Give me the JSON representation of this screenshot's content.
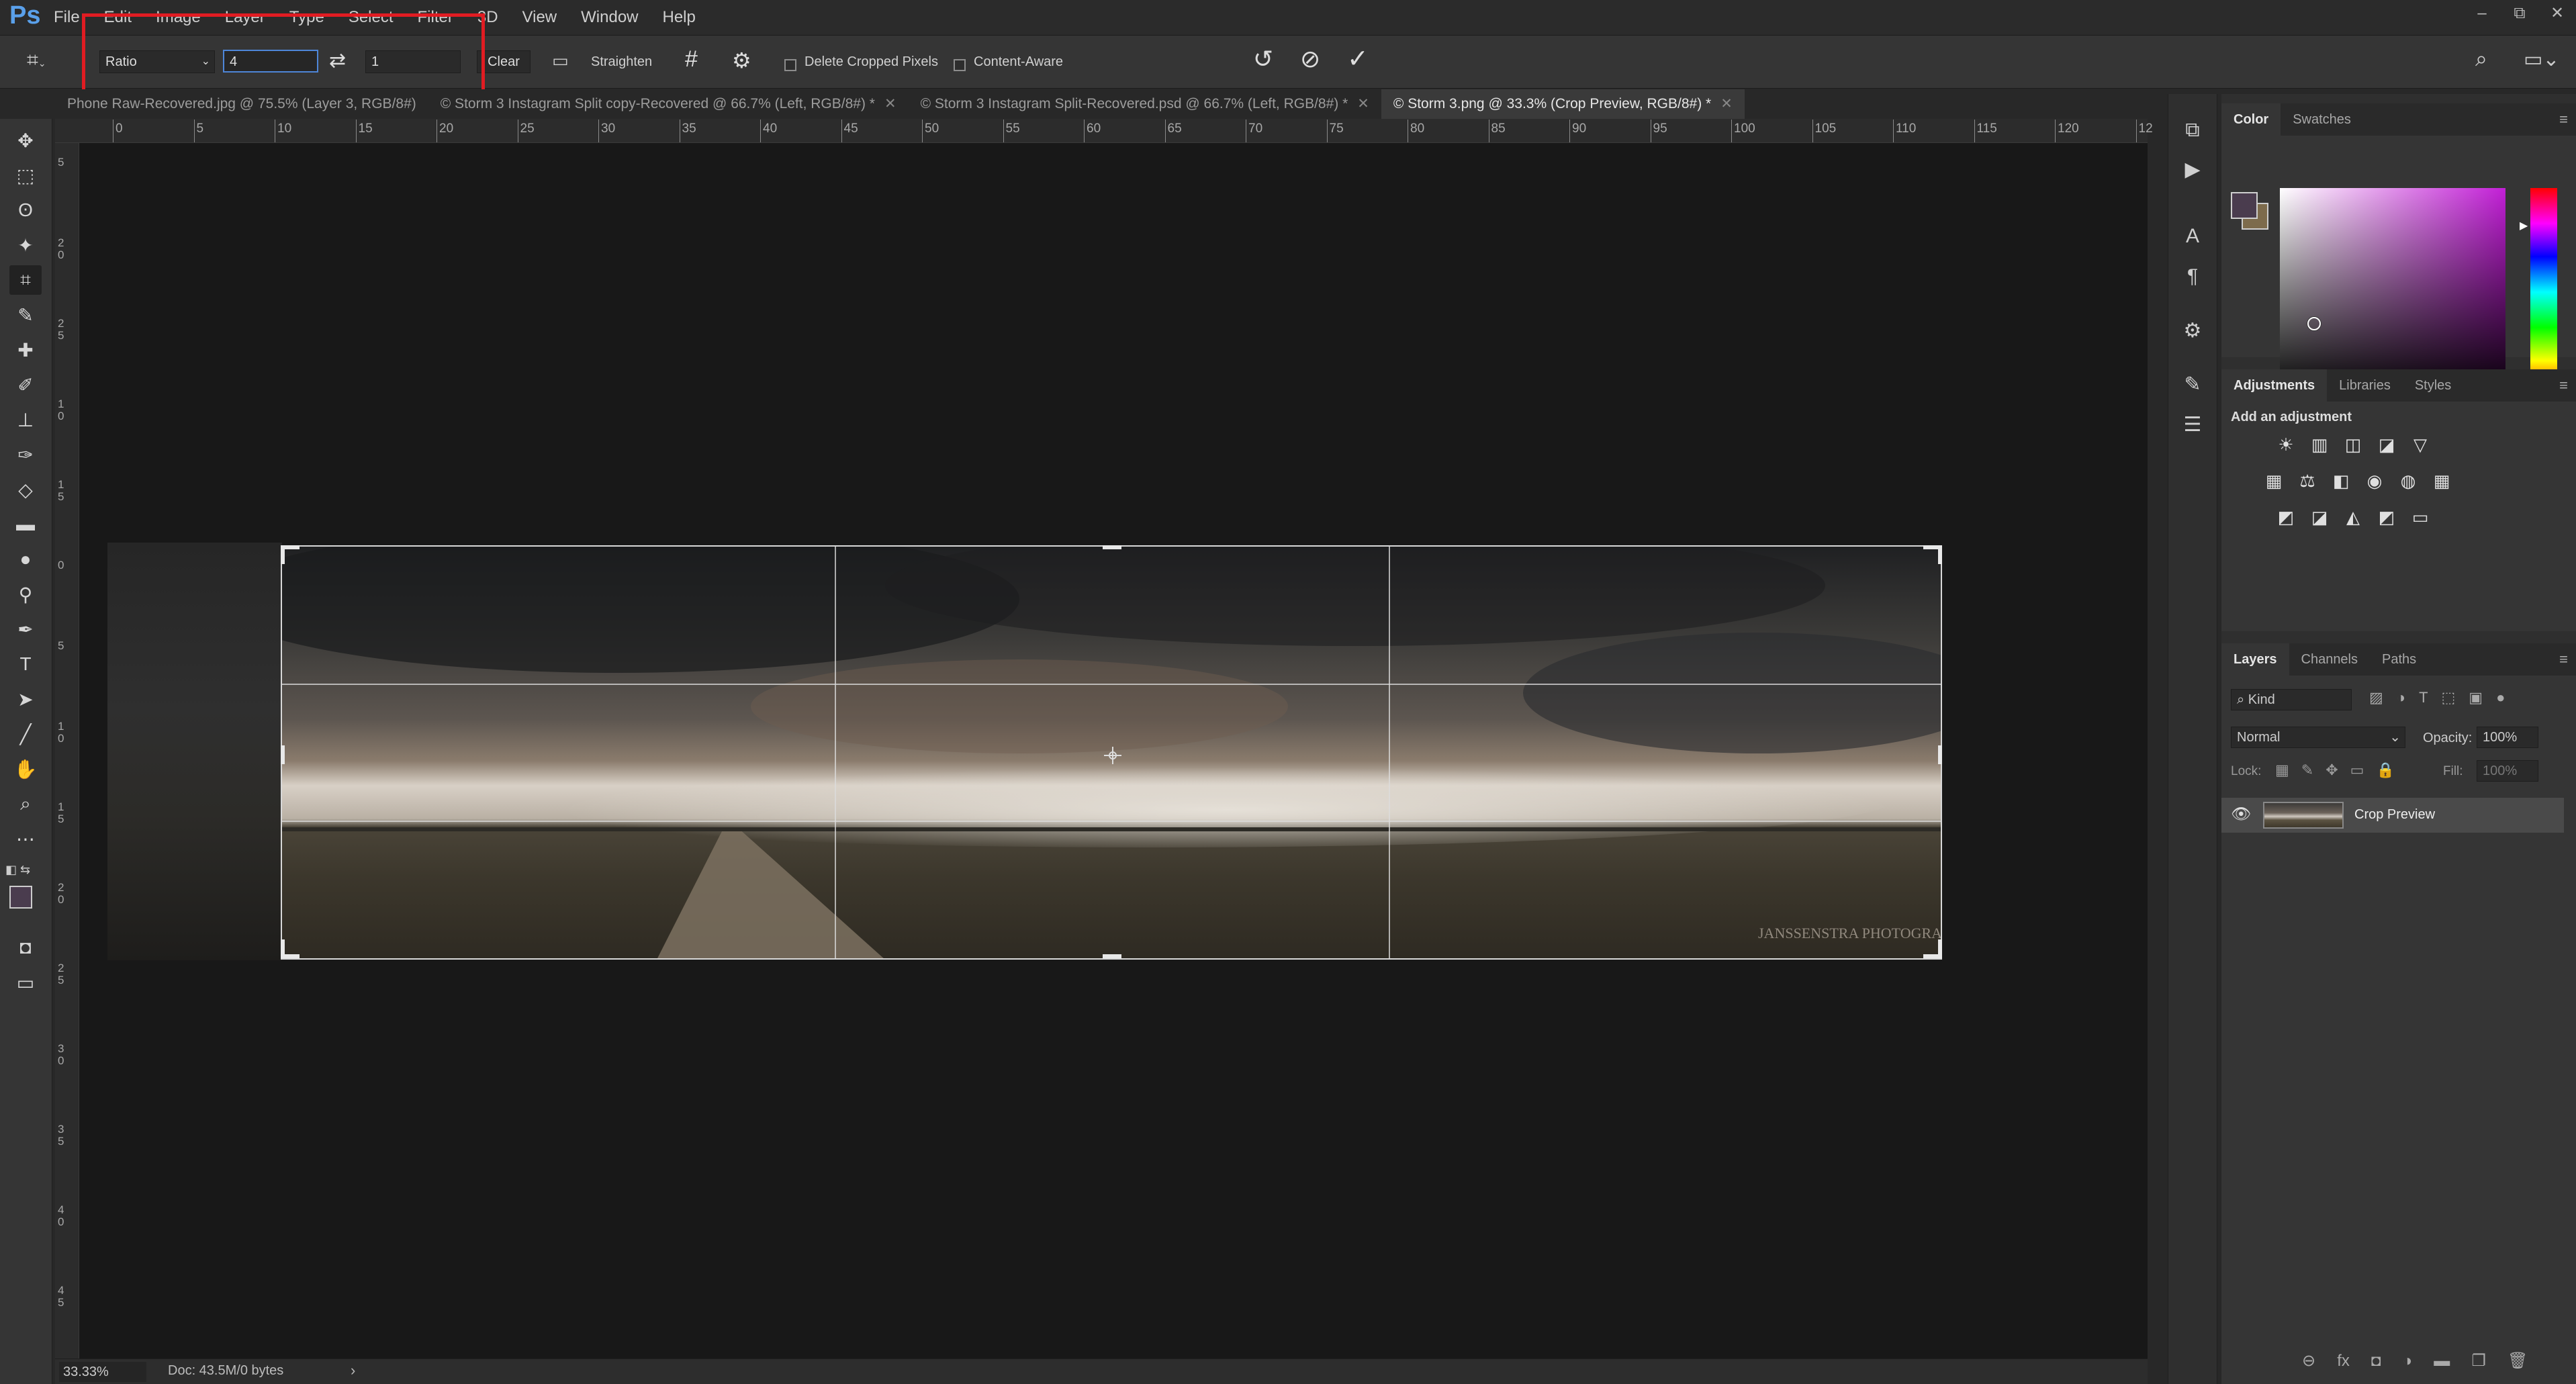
{
  "app": {
    "logo": "Ps"
  },
  "menu": [
    "File",
    "Edit",
    "Image",
    "Layer",
    "Type",
    "Select",
    "Filter",
    "3D",
    "View",
    "Window",
    "Help"
  ],
  "window_controls": [
    "–",
    "⧉",
    "✕"
  ],
  "options_bar": {
    "ratio_preset": "Ratio",
    "ratio_width": "4",
    "ratio_height": "1",
    "swap_icon": "swap-arrows-icon",
    "clear_label": "Clear",
    "straighten_label": "Straighten",
    "delete_cropped_label": "Delete Cropped Pixels",
    "delete_cropped_checked": false,
    "content_aware_label": "Content-Aware",
    "content_aware_checked": false,
    "highlight_color": "#e11c22"
  },
  "tabs": [
    {
      "label": "Phone Raw-Recovered.jpg @ 75.5% (Layer 3, RGB/8#)",
      "close": ""
    },
    {
      "label": "© Storm 3 Instagram Split copy-Recovered @ 66.7% (Left, RGB/8#) *",
      "close": "✕"
    },
    {
      "label": "© Storm 3 Instagram Split-Recovered.psd @ 66.7% (Left, RGB/8#) *",
      "close": "✕"
    },
    {
      "label": "© Storm 3.png @ 33.3% (Crop Preview, RGB/8#) *",
      "close": "✕",
      "active": true
    }
  ],
  "ruler": {
    "top_labels": [
      "0",
      "5",
      "10",
      "15",
      "20",
      "25",
      "30",
      "35",
      "40",
      "45",
      "50",
      "55",
      "60",
      "65",
      "70",
      "75",
      "80",
      "85",
      "90",
      "95",
      "100",
      "105",
      "110",
      "115",
      "120",
      "12"
    ],
    "left_labels": [
      "5",
      "2 0",
      "2 5",
      "1 0",
      "1 5",
      "0",
      "5",
      "1 0",
      "1 5",
      "2 0",
      "2 5",
      "3 0",
      "3 5",
      "4 0",
      "4 5"
    ]
  },
  "status": {
    "zoom": "33.33%",
    "doc": "Doc: 43.5M/0 bytes",
    "arrow": "›"
  },
  "color_panel": {
    "tabs": [
      "Color",
      "Swatches"
    ],
    "foreground": "#4a3c4e",
    "background": "#7d6b4c",
    "hue_color": "#c21fd6"
  },
  "adjustments_panel": {
    "tabs": [
      "Adjustments",
      "Libraries",
      "Styles"
    ],
    "heading": "Add an adjustment",
    "row1": [
      "☀",
      "▥",
      "◫",
      "◪",
      "▽"
    ],
    "row2": [
      "▦",
      "⚖",
      "◧",
      "◉",
      "◍",
      "▦"
    ],
    "row3": [
      "◩",
      "◪",
      "◭",
      "◩",
      "▭"
    ]
  },
  "layers_panel": {
    "tabs": [
      "Layers",
      "Channels",
      "Paths"
    ],
    "filter_placeholder": "Kind",
    "blend_mode": "Normal",
    "opacity_label": "Opacity:",
    "opacity": "100%",
    "lock_label": "Lock:",
    "fill_label": "Fill:",
    "fill": "100%",
    "layers": [
      {
        "name": "Crop Preview",
        "visible": true
      }
    ],
    "bottom_icons": [
      "⊖",
      "fx",
      "◘",
      "◑",
      "▬",
      "❐",
      "🗑"
    ]
  },
  "watermark": "JANSSENSTRA PHOTOGRAPHY"
}
